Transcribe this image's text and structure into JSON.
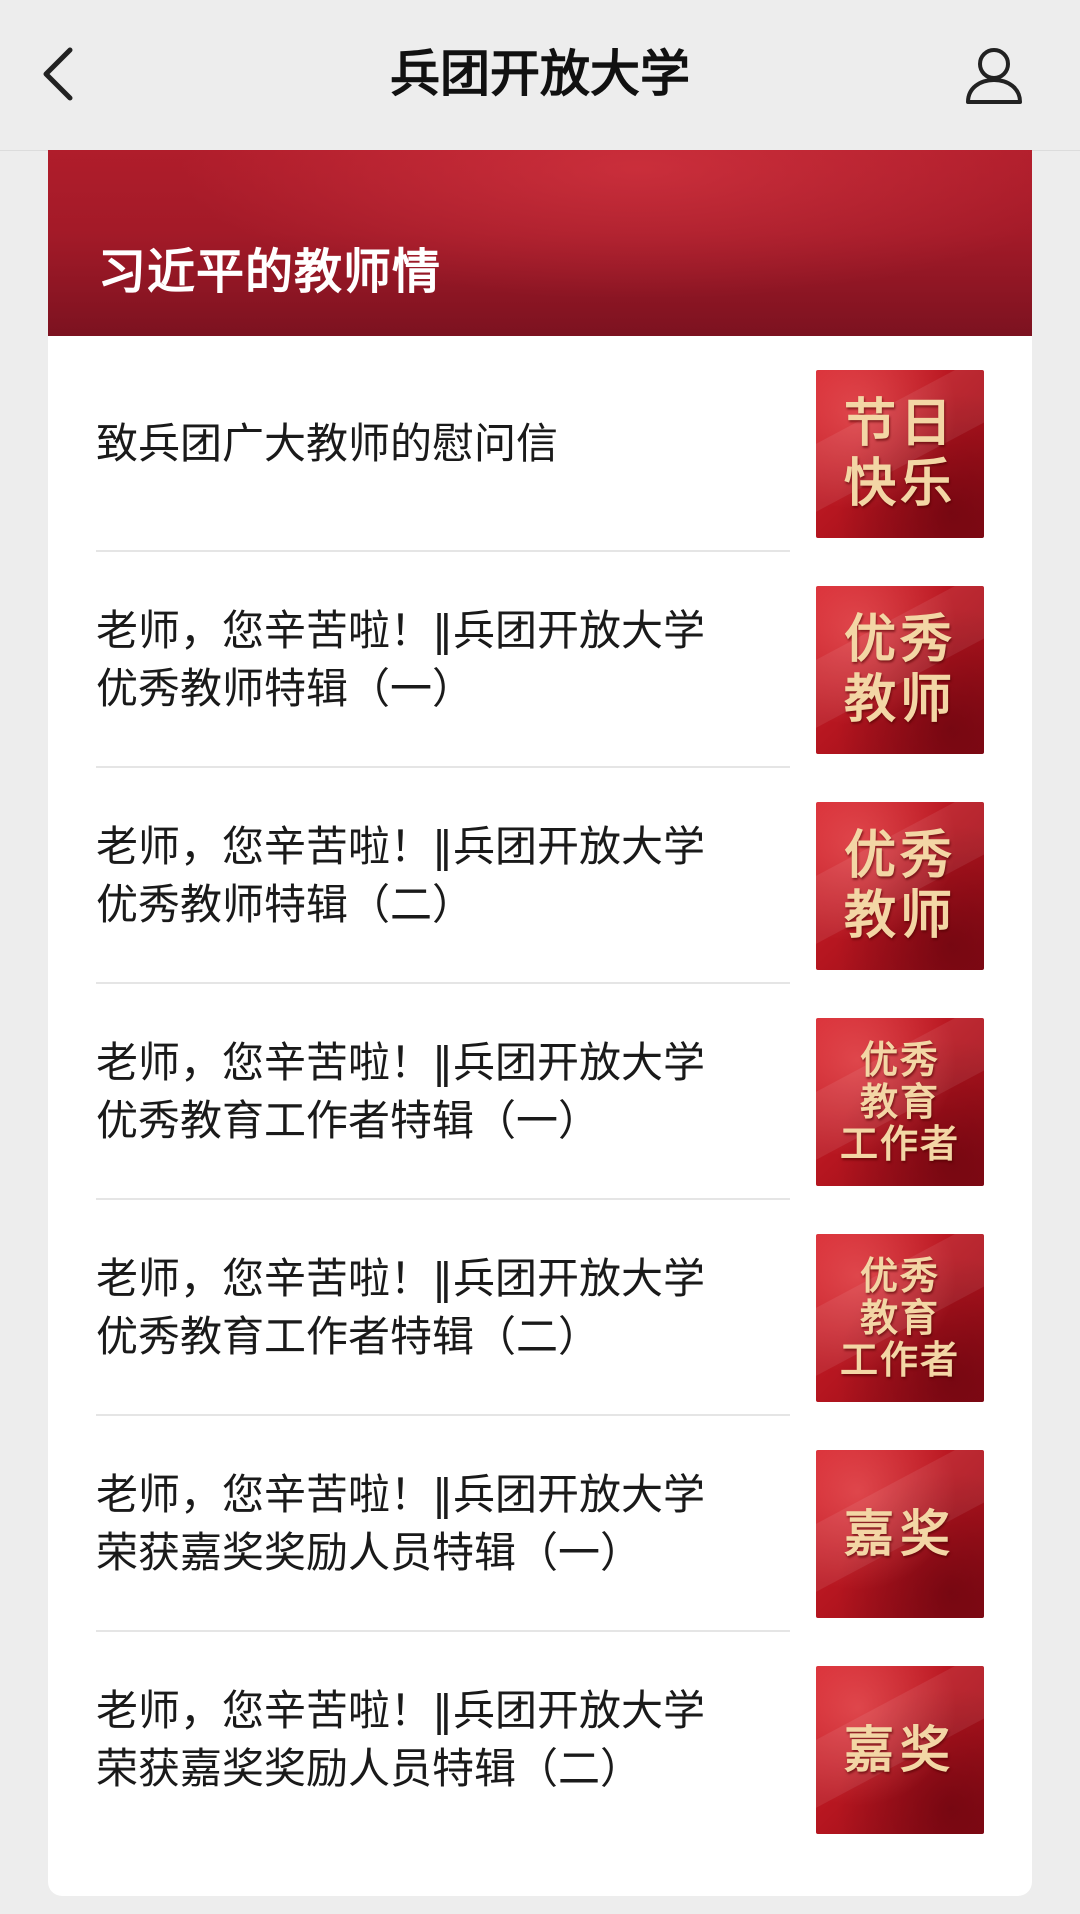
{
  "navbar": {
    "title": "兵团开放大学",
    "back_icon": "chevron-left-icon",
    "profile_icon": "user-icon"
  },
  "banner": {
    "title": "习近平的教师情"
  },
  "articles": [
    {
      "title_lines": [
        "致兵团广大教师的慰问信"
      ],
      "thumb": "节日\n快乐"
    },
    {
      "title_lines": [
        "老师，您辛苦啦！‖兵团开放大学",
        "优秀教师特辑（一）"
      ],
      "thumb": "优秀\n教师"
    },
    {
      "title_lines": [
        "老师，您辛苦啦！‖兵团开放大学",
        "优秀教师特辑（二）"
      ],
      "thumb": "优秀\n教师"
    },
    {
      "title_lines": [
        "老师，您辛苦啦！‖兵团开放大学",
        "优秀教育工作者特辑（一）"
      ],
      "thumb": "优秀\n教育\n工作者"
    },
    {
      "title_lines": [
        "老师，您辛苦啦！‖兵团开放大学",
        "优秀教育工作者特辑（二）"
      ],
      "thumb": "优秀\n教育\n工作者"
    },
    {
      "title_lines": [
        "老师，您辛苦啦！‖兵团开放大学",
        "荣获嘉奖奖励人员特辑（一）"
      ],
      "thumb": "嘉奖"
    },
    {
      "title_lines": [
        "老师，您辛苦啦！‖兵团开放大学",
        "荣获嘉奖奖励人员特辑（二）"
      ],
      "thumb": "嘉奖"
    }
  ],
  "colors": {
    "accent_red": "#b01d2b",
    "thumb_text": "#f3d6a5"
  }
}
